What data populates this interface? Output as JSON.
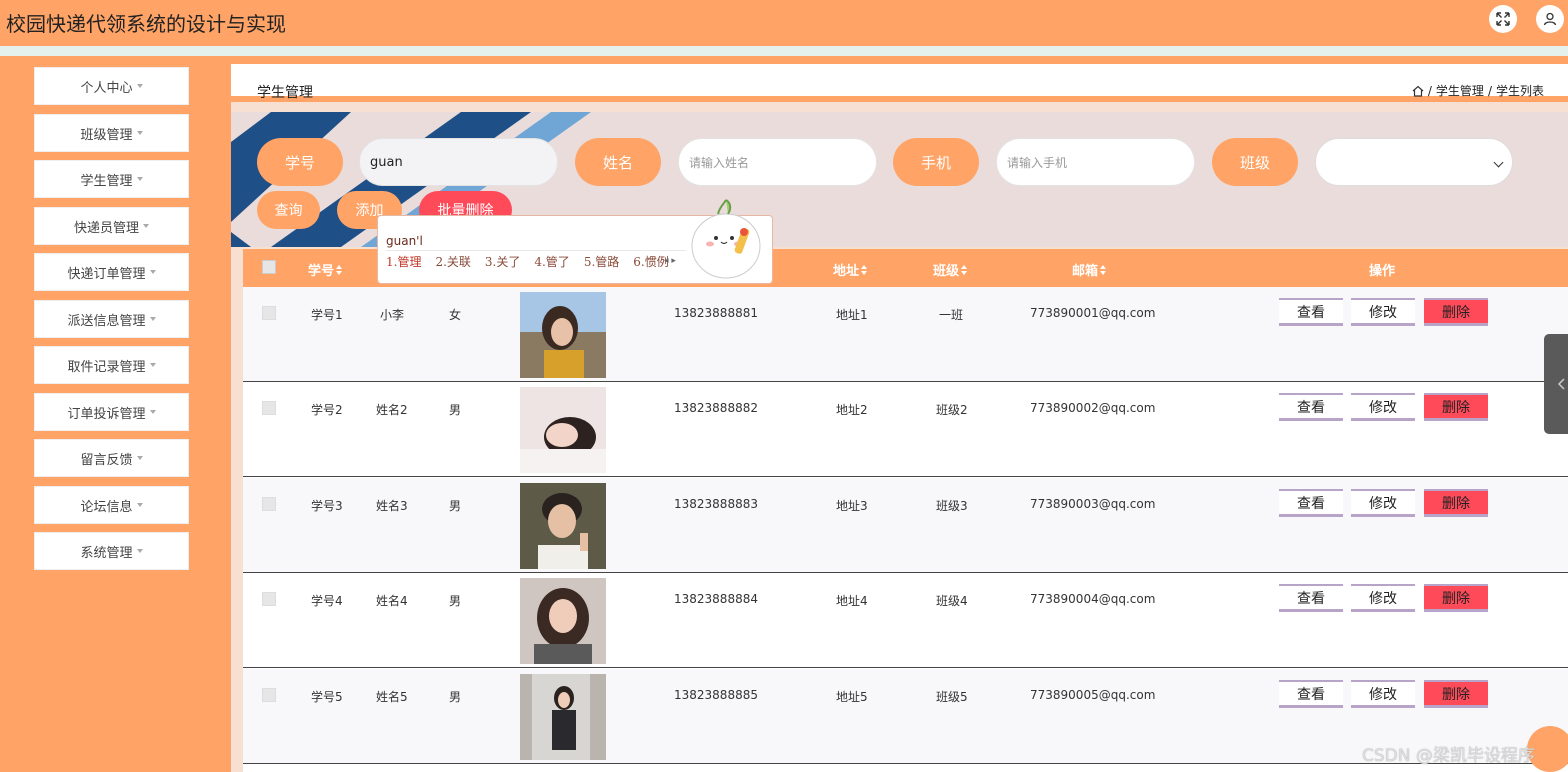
{
  "header": {
    "title": "校园快递代领系统的设计与实现"
  },
  "sidebar": {
    "items": [
      {
        "label": "个人中心"
      },
      {
        "label": "班级管理"
      },
      {
        "label": "学生管理"
      },
      {
        "label": "快递员管理"
      },
      {
        "label": "快递订单管理"
      },
      {
        "label": "派送信息管理"
      },
      {
        "label": "取件记录管理"
      },
      {
        "label": "订单投诉管理"
      },
      {
        "label": "留言反馈"
      },
      {
        "label": "论坛信息"
      },
      {
        "label": "系统管理"
      }
    ]
  },
  "page": {
    "title": "学生管理",
    "breadcrumb_sep": "/",
    "breadcrumb": [
      "学生管理",
      "学生列表"
    ]
  },
  "search": {
    "labels": {
      "id": "学号",
      "name": "姓名",
      "phone": "手机",
      "class": "班级"
    },
    "id_value": "guan",
    "name_placeholder": "请输入姓名",
    "phone_placeholder": "请输入手机",
    "class_value": ""
  },
  "actions": {
    "query": "查询",
    "add": "添加",
    "batch_delete": "批量删除"
  },
  "ime": {
    "composition": "guan'l",
    "candidates": [
      "1.管理",
      "2.关联",
      "3.关了",
      "4.管了",
      "5.管路",
      "6.惯例"
    ]
  },
  "table": {
    "headers": {
      "id": "学号",
      "address": "地址",
      "class": "班级",
      "email": "邮箱",
      "ops": "操作"
    },
    "row_buttons": {
      "view": "查看",
      "edit": "修改",
      "delete": "删除"
    },
    "rows": [
      {
        "id": "学号1",
        "name": "小李",
        "gender": "女",
        "phone": "13823888881",
        "address": "地址1",
        "class": "一班",
        "email": "773890001@qq.com"
      },
      {
        "id": "学号2",
        "name": "姓名2",
        "gender": "男",
        "phone": "13823888882",
        "address": "地址2",
        "class": "班级2",
        "email": "773890002@qq.com"
      },
      {
        "id": "学号3",
        "name": "姓名3",
        "gender": "男",
        "phone": "13823888883",
        "address": "地址3",
        "class": "班级3",
        "email": "773890003@qq.com"
      },
      {
        "id": "学号4",
        "name": "姓名4",
        "gender": "男",
        "phone": "13823888884",
        "address": "地址4",
        "class": "班级4",
        "email": "773890004@qq.com"
      },
      {
        "id": "学号5",
        "name": "姓名5",
        "gender": "男",
        "phone": "13823888885",
        "address": "地址5",
        "class": "班级5",
        "email": "773890005@qq.com"
      }
    ]
  },
  "watermark": "CSDN @梁凯毕设程序",
  "colors": {
    "accent": "#ffa466",
    "danger": "#ff4a5a",
    "band": "#e4f1ec"
  }
}
